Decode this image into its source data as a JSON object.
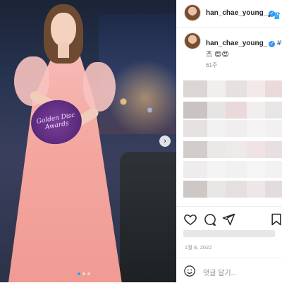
{
  "post": {
    "username": "han_chae_young_",
    "verified_mark": "✓",
    "separator": "•",
    "follow_label": "팔",
    "award_text": "Golden Disc Awards",
    "next_button_icon": "chevron-right-icon",
    "carousel_dots": 3,
    "carousel_active_index": 1
  },
  "caption": {
    "username": "han_chae_young_",
    "text_start": "#골",
    "text_line2": "즈 😍😍",
    "age": "61주"
  },
  "actions": {
    "like_icon": "heart-icon",
    "comment_icon": "comment-icon",
    "share_icon": "send-icon",
    "save_icon": "bookmark-icon"
  },
  "meta": {
    "date": "1월 8, 2022"
  },
  "comment_box": {
    "emoji_icon": "smiley-icon",
    "placeholder": "댓글 달기..."
  },
  "colors": {
    "accent": "#0095f6",
    "verified": "#3897f0",
    "tag": "#00376b"
  }
}
